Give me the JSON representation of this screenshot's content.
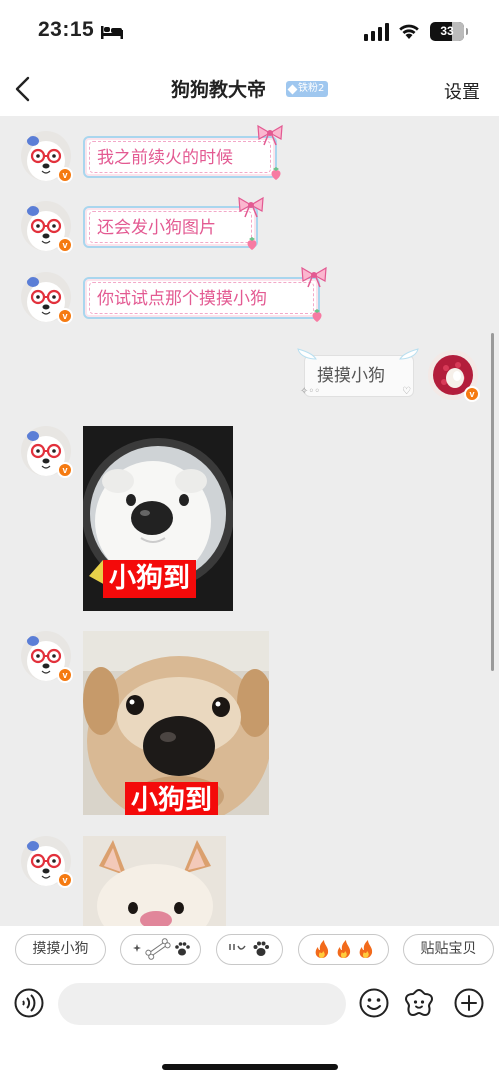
{
  "status_bar": {
    "time": "23:15",
    "battery": "33"
  },
  "nav": {
    "title": "狗狗教大帝",
    "fan_badge": "铁粉2",
    "settings_label": "设置"
  },
  "messages": [
    {
      "sender": "other",
      "type": "text",
      "text": "我之前续火的时候"
    },
    {
      "sender": "other",
      "type": "text",
      "text": "还会发小狗图片"
    },
    {
      "sender": "other",
      "type": "text",
      "text": "你试试点那个摸摸小狗"
    },
    {
      "sender": "self",
      "type": "text",
      "text": "摸摸小狗"
    },
    {
      "sender": "other",
      "type": "image",
      "caption": "小狗到"
    },
    {
      "sender": "other",
      "type": "image",
      "caption": "小狗到"
    },
    {
      "sender": "other",
      "type": "image",
      "caption": ""
    }
  ],
  "quick_replies": [
    {
      "label": "摸摸小狗",
      "icon": ""
    },
    {
      "label": "",
      "icon": "sparkle-bone-paw-icon"
    },
    {
      "label": "",
      "icon": "face-paw-icon"
    },
    {
      "label": "",
      "icon": "fire-fire-fire-icon"
    },
    {
      "label": "贴贴宝贝",
      "icon": ""
    }
  ],
  "input": {
    "placeholder": ""
  },
  "colors": {
    "accent": "#f57a11",
    "bubble_text_pink": "#e35a92",
    "caption_red": "#f40a0a",
    "badge_blue": "#9fc7ef"
  }
}
